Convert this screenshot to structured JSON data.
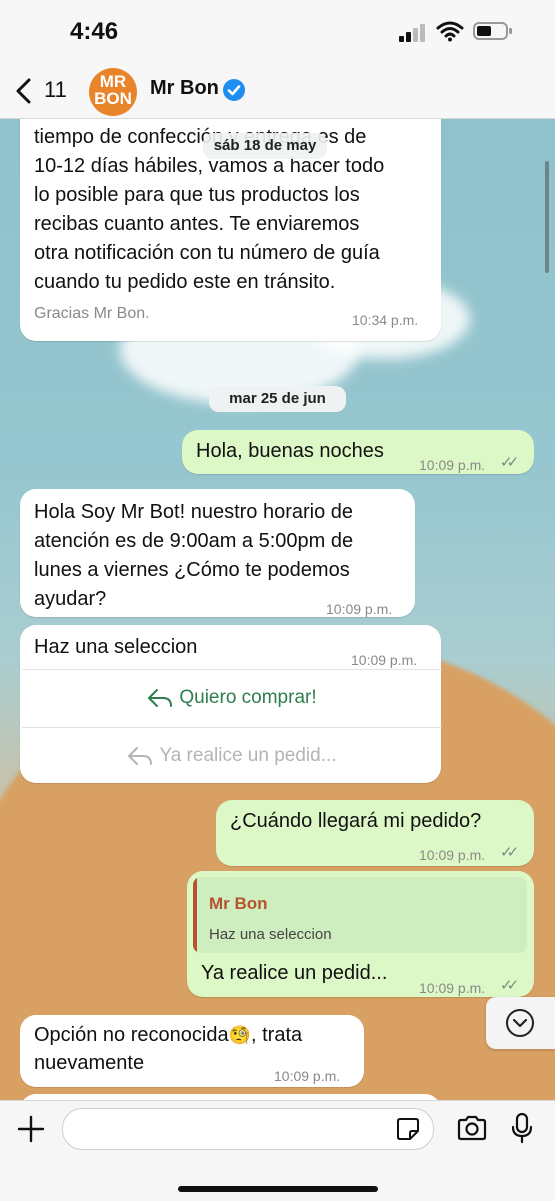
{
  "status_bar": {
    "time": "4:46"
  },
  "header": {
    "back_count": "11",
    "avatar_line1": "MR",
    "avatar_line2": "BON",
    "contact_name": "Mr Bon"
  },
  "messages": {
    "m1": {
      "lines": [
        "tiempo de confección y entrega es de",
        "10-12 días hábiles, vamos a hacer todo",
        "lo posible para que tus productos los",
        "recibas cuanto antes. Te enviaremos",
        "otra notificación con tu número de guía",
        "cuando tu pedido este en tránsito."
      ],
      "signature": "Gracias Mr Bon.",
      "time": "10:34 p.m."
    },
    "date_sticky": "sáb 18 de may",
    "date_divider": "mar 25 de jun",
    "m2": {
      "text": "Hola, buenas noches",
      "time": "10:09 p.m.",
      "ticks": "✓✓"
    },
    "m3": {
      "lines": [
        "Hola Soy Mr Bot! nuestro horario de",
        "atención es de 9:00am a 5:00pm de",
        "lunes a viernes ¿Cómo te podemos",
        "ayudar?"
      ],
      "time": "10:09 p.m."
    },
    "m4": {
      "text": "Haz una seleccion",
      "time": "10:09 p.m.",
      "button1": "Quiero comprar!",
      "button2": "Ya realice un pedid..."
    },
    "m5": {
      "text": "¿Cuándo llegará mi pedido?",
      "time": "10:09 p.m.",
      "ticks": "✓✓"
    },
    "m6": {
      "quote_author": "Mr Bon",
      "quote_text": "Haz una seleccion",
      "text": "Ya realice un pedid...",
      "time": "10:09 p.m.",
      "ticks": "✓✓"
    },
    "m7": {
      "line1": "Opción no reconocida",
      "emoji": "🧐",
      "line1_end": ", trata",
      "line2": "nuevamente",
      "time": "10:09 p.m."
    }
  },
  "input": {
    "placeholder": ""
  },
  "colors": {
    "accent_green": "#2e7d4f",
    "outgoing_bubble": "#dcf8c6",
    "quote_bar": "#b5532f",
    "verified_blue": "#1f8ef1"
  }
}
